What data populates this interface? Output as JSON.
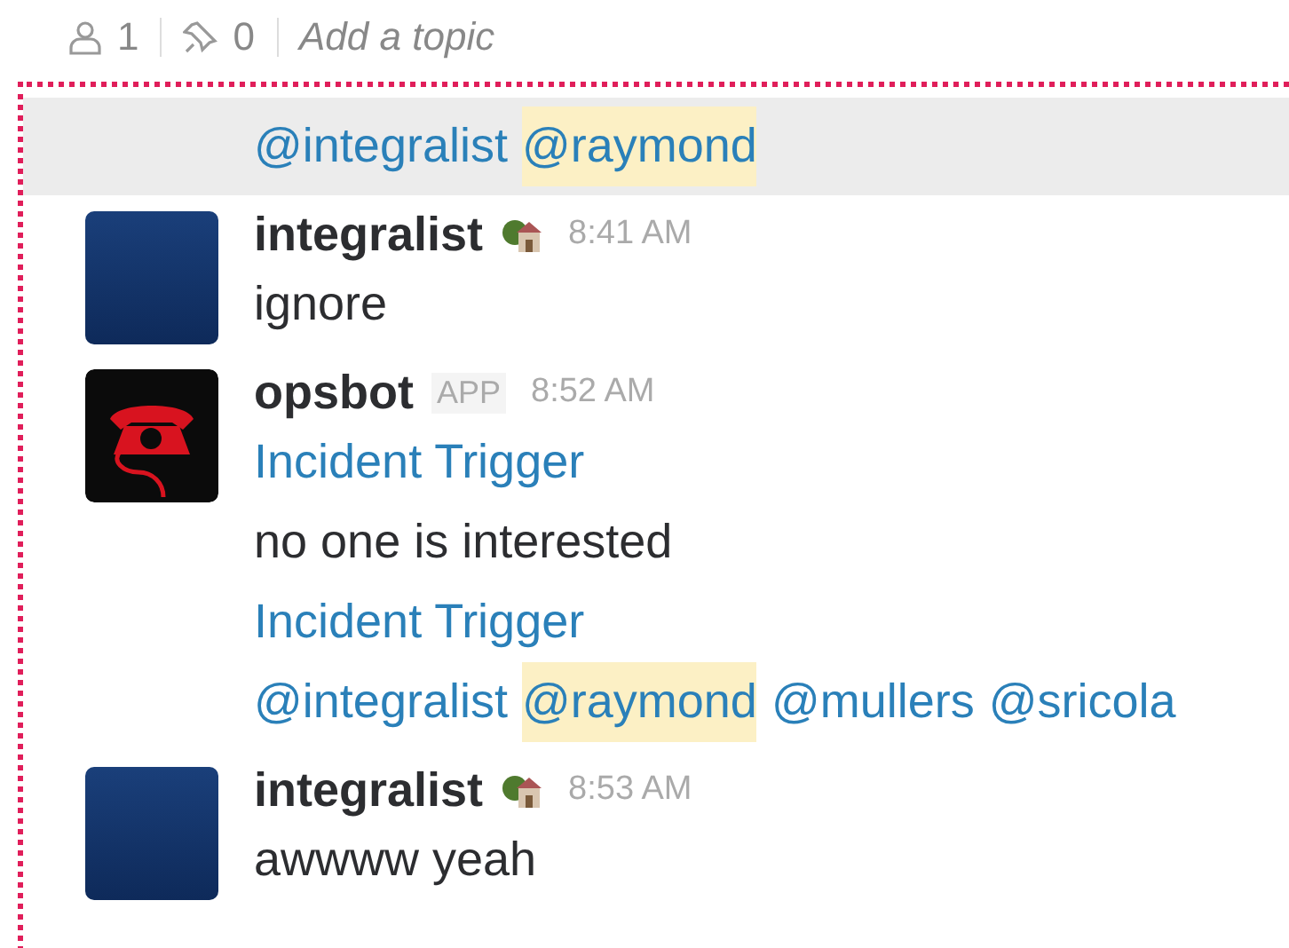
{
  "header": {
    "members": "1",
    "pins": "0",
    "topic": "Add a topic"
  },
  "messages": [
    {
      "kind": "continuation",
      "hovered": true,
      "lines": [
        {
          "kind": "mentions",
          "mentions": [
            {
              "text": "@integralist",
              "highlighted": false
            },
            {
              "text": "@raymond",
              "highlighted": true
            }
          ]
        }
      ]
    },
    {
      "kind": "message",
      "hovered": false,
      "avatar": {
        "kind": "photo"
      },
      "author": "integralist",
      "status_emoji": true,
      "time": "8:41 AM",
      "lines": [
        {
          "kind": "text",
          "text": "ignore"
        }
      ]
    },
    {
      "kind": "message",
      "hovered": false,
      "avatar": {
        "kind": "phone_logo"
      },
      "author": "opsbot",
      "badge": "APP",
      "time": "8:52 AM",
      "lines": [
        {
          "kind": "link",
          "text": "Incident Trigger"
        },
        {
          "kind": "text",
          "text": "no one is interested"
        },
        {
          "kind": "link",
          "text": "Incident Trigger"
        },
        {
          "kind": "mentions",
          "mentions": [
            {
              "text": "@integralist",
              "highlighted": false
            },
            {
              "text": "@raymond",
              "highlighted": true
            },
            {
              "text": "@mullers",
              "highlighted": false
            },
            {
              "text": "@sricola",
              "highlighted": false
            }
          ]
        }
      ]
    },
    {
      "kind": "message",
      "hovered": false,
      "avatar": {
        "kind": "photo"
      },
      "author": "integralist",
      "status_emoji": true,
      "time": "8:53 AM",
      "lines": [
        {
          "kind": "text",
          "text": "awwww yeah"
        }
      ]
    }
  ]
}
